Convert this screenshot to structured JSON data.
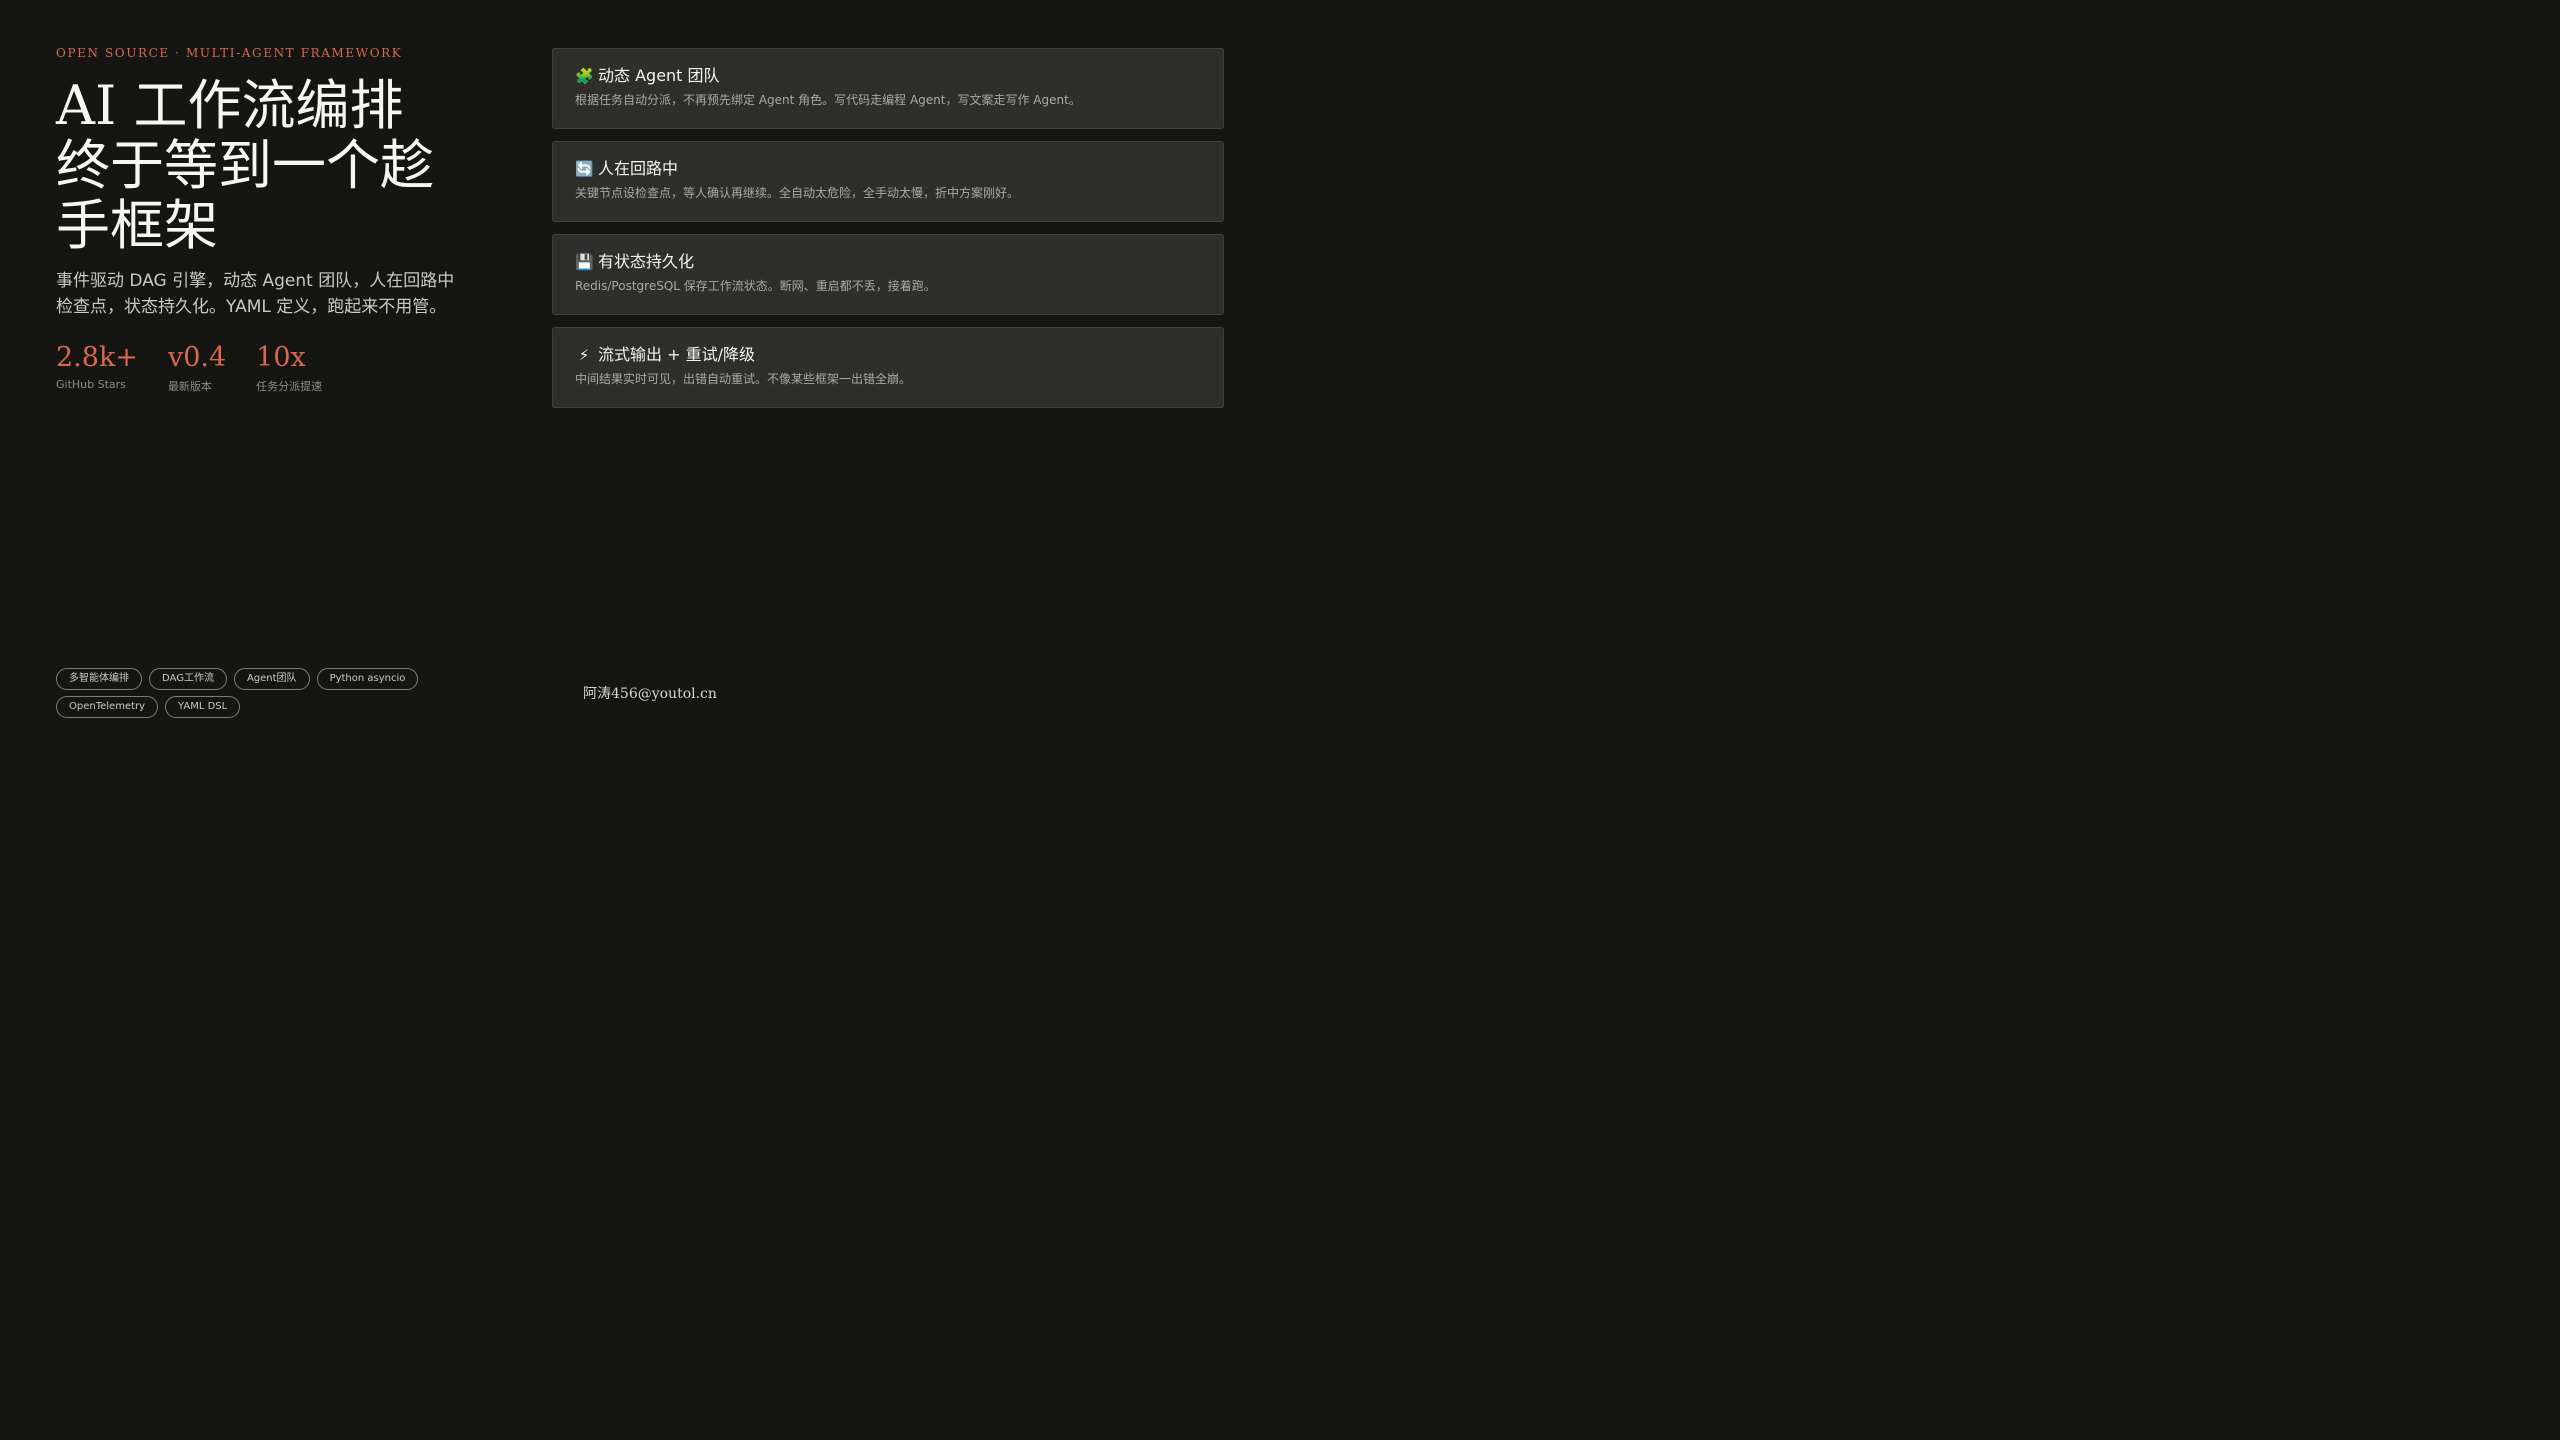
{
  "hero": {
    "eyebrow": "OPEN SOURCE · MULTI-AGENT FRAMEWORK",
    "title": "AI 工作流编排\n终于等到一个趁\n手框架",
    "subtitle": "事件驱动 DAG 引擎，动态 Agent 团队，人在回路中检查点，状态持久化。YAML 定义，跑起来不用管。"
  },
  "stats": [
    {
      "value": "2.8k+",
      "label": "GitHub Stars"
    },
    {
      "value": "v0.4",
      "label": "最新版本"
    },
    {
      "value": "10x",
      "label": "任务分派提速"
    }
  ],
  "tags": [
    "多智能体编排",
    "DAG工作流",
    "Agent团队",
    "Python asyncio",
    "OpenTelemetry",
    "YAML DSL"
  ],
  "features": [
    {
      "icon": "🧩",
      "icon_name": "puzzle-icon",
      "title": "动态 Agent 团队",
      "desc": "根据任务自动分派，不再预先绑定 Agent 角色。写代码走编程 Agent，写文案走写作 Agent。"
    },
    {
      "icon": "🔄",
      "icon_name": "cycle-arrows-icon",
      "title": "人在回路中",
      "desc": "关键节点设检查点，等人确认再继续。全自动太危险，全手动太慢，折中方案刚好。"
    },
    {
      "icon": "💾",
      "icon_name": "floppy-disk-icon",
      "title": "有状态持久化",
      "desc": "Redis/PostgreSQL 保存工作流状态。断网、重启都不丢，接着跑。"
    },
    {
      "icon": "⚡",
      "icon_name": "lightning-icon",
      "title": "流式输出 + 重试/降级",
      "desc": "中间结果实时可见，出错自动重试。不像某些框架一出错全崩。"
    }
  ],
  "author": "阿涛456@youtol.cn",
  "colors": {
    "background": "#151514",
    "accent": "#d9694a",
    "card_bg": "#2e2e2c"
  }
}
